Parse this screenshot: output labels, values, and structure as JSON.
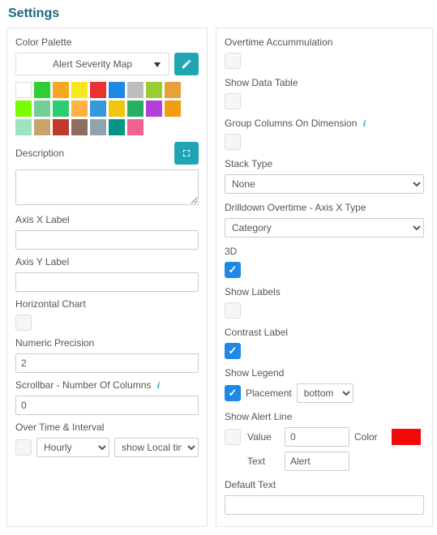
{
  "title": "Settings",
  "left": {
    "color_palette_label": "Color Palette",
    "palette_selected": "Alert Severity Map",
    "swatches": [
      "#ffffff",
      "#32cd32",
      "#f5a623",
      "#f8e71c",
      "#ec3131",
      "#1e88e5",
      "#bdbdbd",
      "#9acd32",
      "#e8a13a",
      "#7cfc00",
      "#6fcf97",
      "#2ecc71",
      "#ffb142",
      "#3498db",
      "#f1c40f",
      "#27ae60",
      "#b340d6",
      "#f39c12",
      "#9fe2bf",
      "#c8a46a",
      "#c0392b",
      "#8d6e63",
      "#90a4ae",
      "#009688",
      "#f06292"
    ],
    "description_label": "Description",
    "description_value": "",
    "axis_x_label": "Axis X Label",
    "axis_x_value": "",
    "axis_y_label": "Axis Y Label",
    "axis_y_value": "",
    "horizontal_chart_label": "Horizontal Chart",
    "numeric_precision_label": "Numeric Precision",
    "numeric_precision_value": "2",
    "scrollbar_label": "Scrollbar - Number Of Columns",
    "scrollbar_value": "0",
    "overtime_interval_label": "Over Time & Interval",
    "overtime_interval_value": "Hourly",
    "localtime_value": "show Local time"
  },
  "right": {
    "overtime_accum_label": "Overtime Accummulation",
    "show_data_table_label": "Show Data Table",
    "group_columns_label": "Group Columns On Dimension",
    "stack_type_label": "Stack Type",
    "stack_type_value": "None",
    "drilldown_axisx_label": "Drilldown Overtime - Axis X Type",
    "drilldown_axisx_value": "Category",
    "threeD_label": "3D",
    "show_labels_label": "Show Labels",
    "contrast_label_label": "Contrast Label",
    "show_legend_label": "Show Legend",
    "placement_label": "Placement",
    "placement_value": "bottom",
    "show_alert_line_label": "Show Alert Line",
    "alert_value_label": "Value",
    "alert_value": "0",
    "alert_color_label": "Color",
    "alert_color": "#f30808",
    "alert_text_label": "Text",
    "alert_text_value": "Alert",
    "default_text_label": "Default Text",
    "default_text_value": ""
  }
}
